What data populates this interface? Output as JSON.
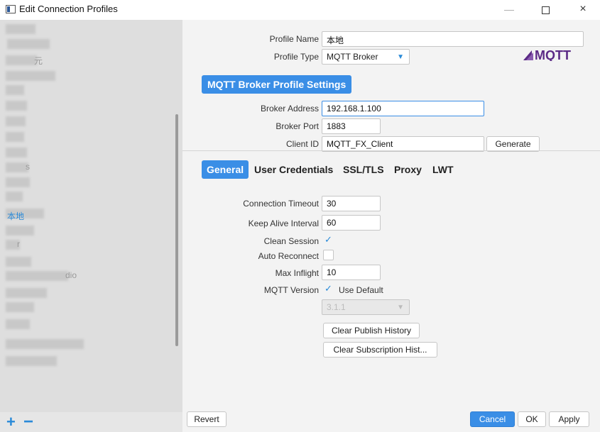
{
  "window": {
    "title": "Edit Connection Profiles",
    "minimize_glyph": "—",
    "close_glyph": "×"
  },
  "sidebar": {
    "selected_profile": "本地",
    "blurred_items": [
      {
        "visible_text": ""
      },
      {
        "visible_text": ""
      },
      {
        "visible_text": "元"
      },
      {
        "visible_text": ""
      },
      {
        "visible_text": ""
      },
      {
        "visible_text": ""
      },
      {
        "visible_text": ""
      },
      {
        "visible_text": ""
      },
      {
        "visible_text": ""
      },
      {
        "visible_text": "s"
      },
      {
        "visible_text": ""
      },
      {
        "visible_text": ""
      },
      {
        "visible_text": ""
      },
      {
        "visible_text": ""
      },
      {
        "visible_text": "r"
      },
      {
        "visible_text": ""
      },
      {
        "visible_text": "dio"
      },
      {
        "visible_text": ""
      },
      {
        "visible_text": ""
      },
      {
        "visible_text": ""
      },
      {
        "visible_text": ""
      },
      {
        "visible_text": ""
      }
    ],
    "add_glyph": "+",
    "remove_glyph": "−"
  },
  "profile": {
    "name_label": "Profile Name",
    "name_value": "本地",
    "type_label": "Profile Type",
    "type_value": "MQTT Broker",
    "logo_text": "MQTT"
  },
  "broker": {
    "section_heading": "MQTT Broker Profile Settings",
    "address_label": "Broker Address",
    "address_value": "192.168.1.100",
    "port_label": "Broker Port",
    "port_value": "1883",
    "client_id_label": "Client ID",
    "client_id_value": "MQTT_FX_Client",
    "generate_label": "Generate"
  },
  "tabs": [
    {
      "label": "General",
      "active": true
    },
    {
      "label": "User Credentials",
      "active": false
    },
    {
      "label": "SSL/TLS",
      "active": false
    },
    {
      "label": "Proxy",
      "active": false
    },
    {
      "label": "LWT",
      "active": false
    }
  ],
  "general": {
    "conn_timeout_label": "Connection Timeout",
    "conn_timeout_value": "30",
    "keep_alive_label": "Keep Alive Interval",
    "keep_alive_value": "60",
    "clean_session_label": "Clean Session",
    "clean_session_checked": true,
    "auto_reconnect_label": "Auto Reconnect",
    "auto_reconnect_checked": false,
    "max_inflight_label": "Max Inflight",
    "max_inflight_value": "10",
    "mqtt_version_label": "MQTT Version",
    "use_default_label": "Use Default",
    "use_default_checked": true,
    "version_value": "3.1.1",
    "clear_publish_label": "Clear Publish History",
    "clear_subscription_label": "Clear Subscription Hist..."
  },
  "footer": {
    "revert_label": "Revert",
    "cancel_label": "Cancel",
    "ok_label": "OK",
    "apply_label": "Apply"
  },
  "colors": {
    "accent": "#3a8ee6",
    "mqtt_logo": "#5b2a86"
  },
  "icons": {
    "app": "window-icon",
    "dropdown": "chevron-down-icon",
    "check": "checkmark-icon"
  }
}
